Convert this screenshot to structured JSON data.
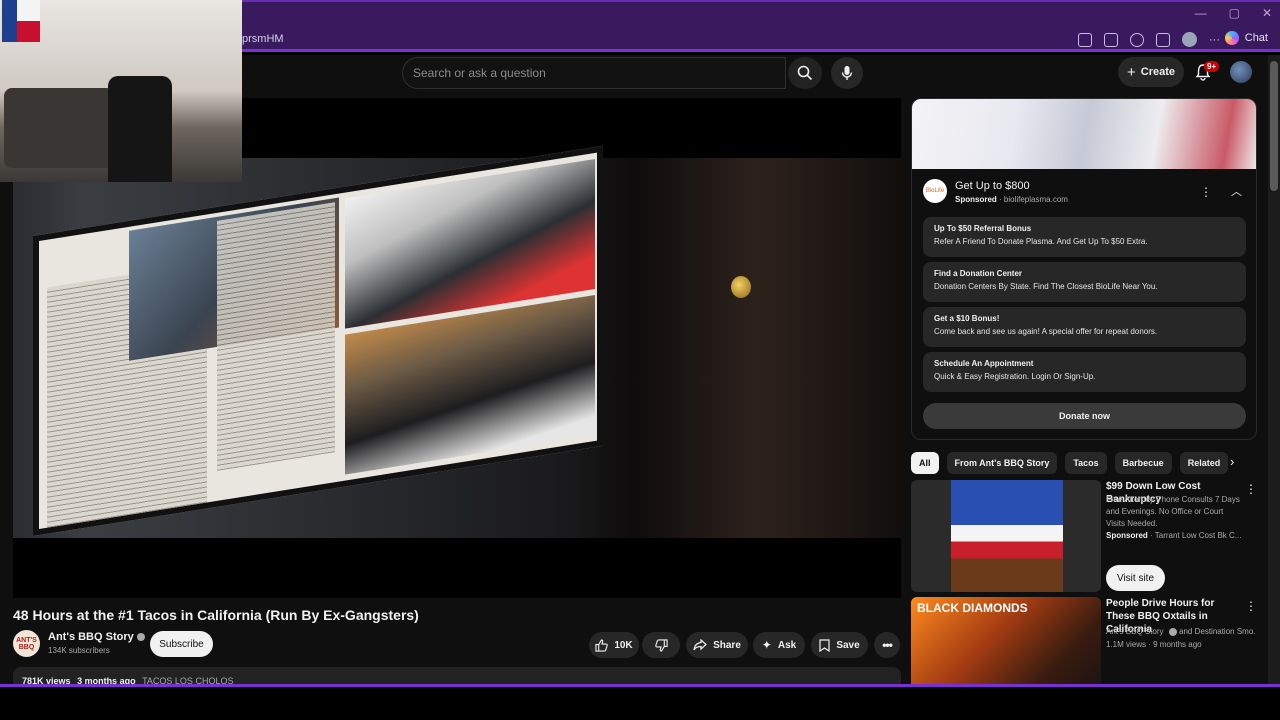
{
  "browser": {
    "url_fragment": "prsmHM",
    "chat_label": "Chat"
  },
  "header": {
    "search_placeholder": "Search or ask a question",
    "create_label": "Create",
    "notif_badge": "9+"
  },
  "video": {
    "title": "48 Hours at the #1 Tacos in California (Run By Ex-Gangsters)",
    "channel_avatar_text": "ANT'S BBQ",
    "channel_name": "Ant's BBQ Story",
    "subscribers": "134K subscribers",
    "subscribe_label": "Subscribe",
    "likes": "10K",
    "share_label": "Share",
    "ask_label": "Ask",
    "save_label": "Save",
    "views": "781K views",
    "age": "3 months ago",
    "tag": "TACOS LOS CHOLOS"
  },
  "ad": {
    "logo_text": "BioLife",
    "title": "Get Up to $800",
    "sponsored": "Sponsored",
    "domain": "· biolifeplasma.com",
    "links": [
      {
        "heading": "Up To $50 Referral Bonus",
        "text": "Refer A Friend To Donate Plasma. And Get Up To $50 Extra."
      },
      {
        "heading": "Find a Donation Center",
        "text": "Donation Centers By State. Find The Closest BioLife Near You."
      },
      {
        "heading": "Get a $10 Bonus!",
        "text": "Come back and see us again! A special offer for repeat donors."
      },
      {
        "heading": "Schedule An Appointment",
        "text": "Quick & Easy Registration. Login Or Sign-Up."
      }
    ],
    "cta": "Donate now"
  },
  "chips": [
    "All",
    "From Ant's BBQ Story",
    "Tacos",
    "Barbecue",
    "Related"
  ],
  "recommendations": [
    {
      "title": "$99 Down Low Cost Bankruptcy",
      "desc": "Free Attorney Phone Consults 7 Days and Evenings. No Office or Court Visits Needed.",
      "sponsored": "Sponsored",
      "advertiser": "· Tarrant Low Cost Bk C...",
      "cta": "Visit site"
    },
    {
      "thumb_label": "BLACK DIAMONDS",
      "title": "People Drive Hours for These BBQ Oxtails in California",
      "channel": "Ant's BBQ Story",
      "collab": "and Destination Smo...",
      "meta": "1.1M views · 9 months ago"
    }
  ],
  "colors": {
    "accent_purple": "#7b2fd4",
    "yt_bg": "#0f0f0f",
    "badge_red": "#cc0000"
  }
}
